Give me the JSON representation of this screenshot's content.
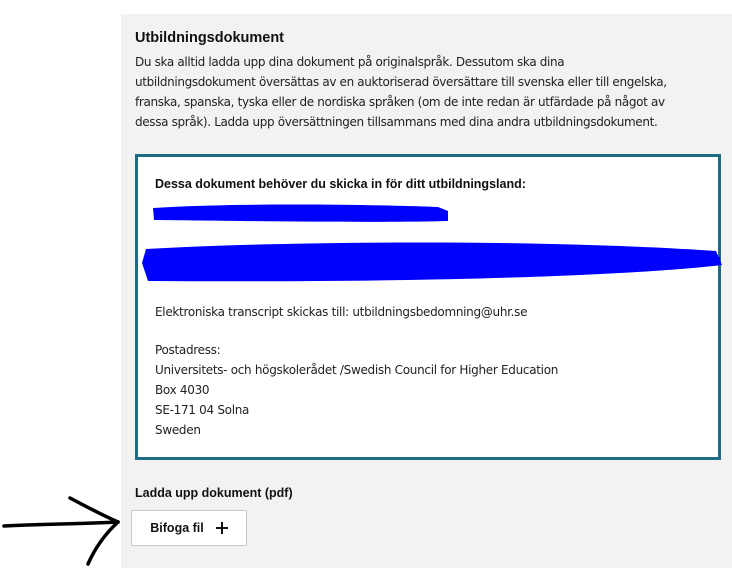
{
  "section": {
    "title": "Utbildningsdokument",
    "intro_lines": [
      "Du ska alltid ladda upp dina dokument på originalspråk. Dessutom ska dina",
      "utbildningsdokument översättas av en auktoriserad översättare till svenska eller till engelska,",
      "franska, spanska, tyska eller de nordiska språken (om de inte redan är utfärdade på något av",
      "dessa språk). Ladda upp översättningen tillsammans med dina andra utbildningsdokument."
    ]
  },
  "document_box": {
    "heading": "Dessa dokument behöver du skicka in för ditt utbildningsland:",
    "redaction_color": "#0000ff",
    "transcript_line": "Elektroniska transcript skickas till: utbildningsbedomning@uhr.se",
    "address_label": "Postadress:",
    "address_lines": [
      "Universitets- och högskolerådet /Swedish Council for Higher Education",
      "Box 4030",
      "SE-171 04 Solna",
      "Sweden"
    ],
    "border_color": "#1e6b86"
  },
  "upload": {
    "label": "Ladda upp dokument (pdf)",
    "button_label": "Bifoga fil",
    "button_icon": "plus-icon"
  },
  "annotation": {
    "icon": "hand-drawn-arrow-icon"
  }
}
